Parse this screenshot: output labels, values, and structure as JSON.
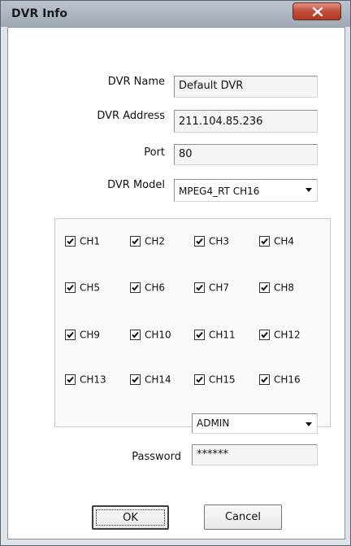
{
  "window": {
    "title": "DVR Info"
  },
  "form": {
    "dvr_name": {
      "label": "DVR Name",
      "value": "Default DVR"
    },
    "dvr_address": {
      "label": "DVR Address",
      "value": "211.104.85.236"
    },
    "port": {
      "label": "Port",
      "value": "80"
    },
    "dvr_model": {
      "label": "DVR Model",
      "value": "MPEG4_RT CH16"
    }
  },
  "channels": [
    {
      "label": "CH1",
      "checked": true
    },
    {
      "label": "CH2",
      "checked": true
    },
    {
      "label": "CH3",
      "checked": true
    },
    {
      "label": "CH4",
      "checked": true
    },
    {
      "label": "CH5",
      "checked": true
    },
    {
      "label": "CH6",
      "checked": true
    },
    {
      "label": "CH7",
      "checked": true
    },
    {
      "label": "CH8",
      "checked": true
    },
    {
      "label": "CH9",
      "checked": true
    },
    {
      "label": "CH10",
      "checked": true
    },
    {
      "label": "CH11",
      "checked": true
    },
    {
      "label": "CH12",
      "checked": true
    },
    {
      "label": "CH13",
      "checked": true
    },
    {
      "label": "CH14",
      "checked": true
    },
    {
      "label": "CH15",
      "checked": true
    },
    {
      "label": "CH16",
      "checked": true
    }
  ],
  "account": {
    "user": "ADMIN",
    "password_label": "Password",
    "password_value": "******"
  },
  "buttons": {
    "ok": "OK",
    "cancel": "Cancel"
  }
}
